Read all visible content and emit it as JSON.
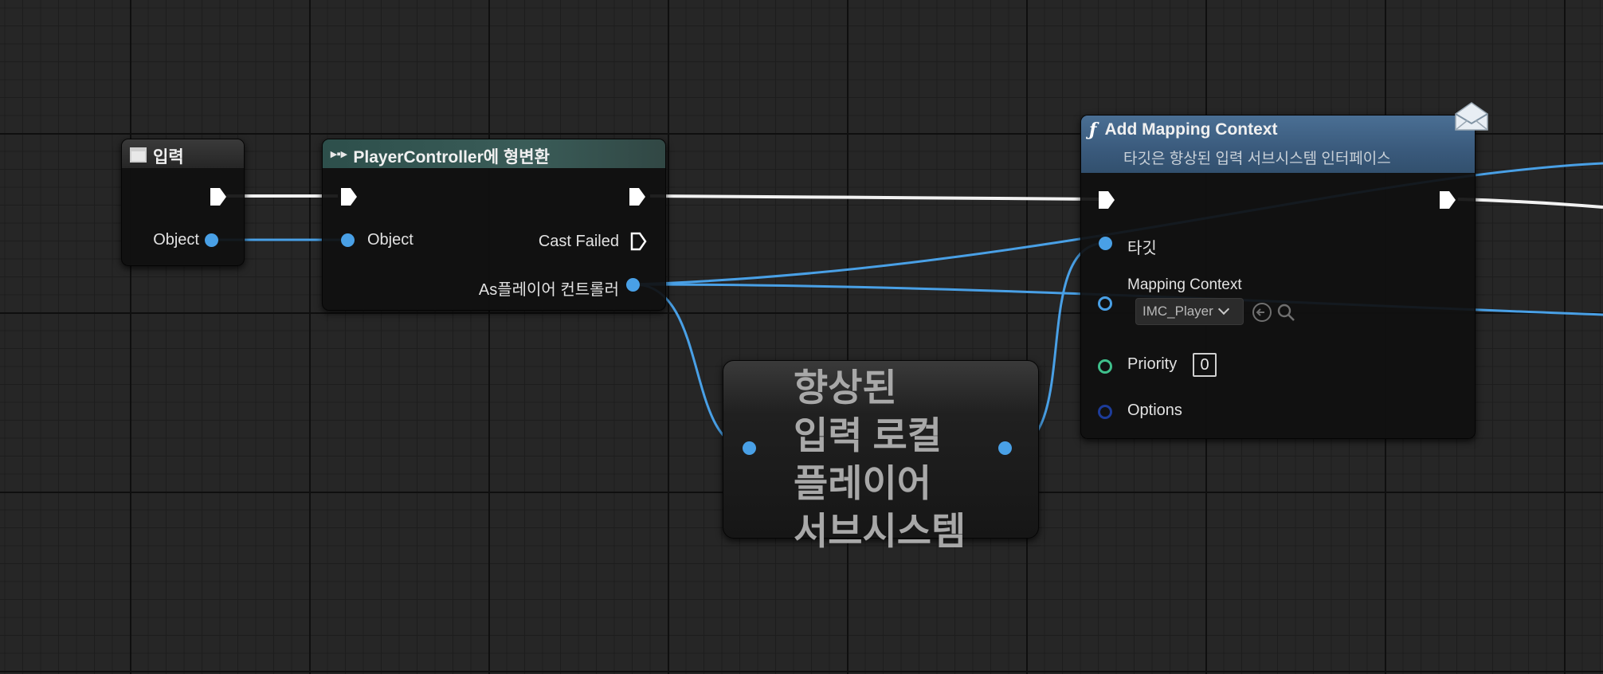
{
  "nodes": {
    "input": {
      "title": "입력",
      "object_label": "Object"
    },
    "cast": {
      "title": "PlayerController에 형변환",
      "object_label": "Object",
      "cast_failed_label": "Cast Failed",
      "as_output_label": "As플레이어 컨트롤러"
    },
    "subsystem": {
      "title_lines": [
        "향상된",
        "입력 로컬",
        "플레이어",
        "서브시스템"
      ]
    },
    "add_mapping_context": {
      "title": "Add Mapping Context",
      "subtitle": "타깃은 향상된 입력 서브시스템 인터페이스",
      "target_label": "타깃",
      "mapping_context_label": "Mapping Context",
      "mapping_context_value": "IMC_Player",
      "priority_label": "Priority",
      "priority_value": "0",
      "options_label": "Options"
    }
  },
  "colors": {
    "object_pin": "#49a0e6",
    "priority_pin": "#3fc08c",
    "options_pin": "#1d3c9a",
    "exec_wire": "#ffffff",
    "cast_header": "#2d4f4b",
    "function_header": "#3c5c7e"
  },
  "icons": {
    "input_node": "event-graph-icon",
    "cast_node": "cast-icon",
    "function_node": "function-icon",
    "message": "envelope-icon",
    "browse": "browse-icon",
    "search": "search-icon"
  }
}
